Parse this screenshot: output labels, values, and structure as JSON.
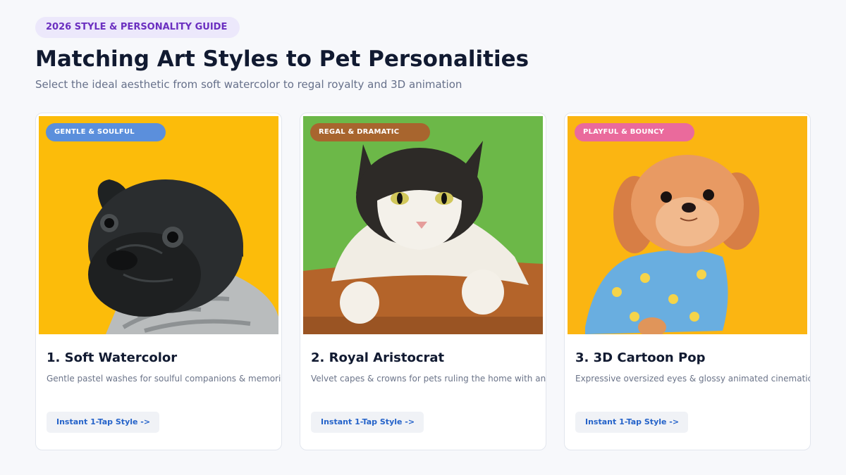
{
  "header": {
    "eyebrow": "2026 STYLE & PERSONALITY GUIDE",
    "title": "Matching Art Styles to Pet Personalities",
    "subtitle": "Select the ideal aesthetic from soft watercolor to regal royalty and 3D animation"
  },
  "cards": [
    {
      "tag": "GENTLE & SOULFUL",
      "tag_color": "#5b8fdc",
      "title": "1. Soft Watercolor",
      "description": "Gentle pastel washes for soulful companions & memorial portraits",
      "cta": "Instant 1-Tap Style ->",
      "image": "black pug in knit sweater on yellow background"
    },
    {
      "tag": "REGAL & DRAMATIC",
      "tag_color": "#a8652e",
      "title": "2. Royal Aristocrat",
      "description": "Velvet capes & crowns for pets ruling the home with an iron paw",
      "cta": "Instant 1-Tap Style ->",
      "image": "black and white cat on green background"
    },
    {
      "tag": "PLAYFUL & BOUNCY",
      "tag_color": "#ea6a9c",
      "title": "3. 3D Cartoon Pop",
      "description": "Expressive oversized eyes & glossy animated cinematic shine",
      "cta": "Instant 1-Tap Style ->",
      "image": "fluffy dog in banana-print shirt on yellow background"
    }
  ]
}
